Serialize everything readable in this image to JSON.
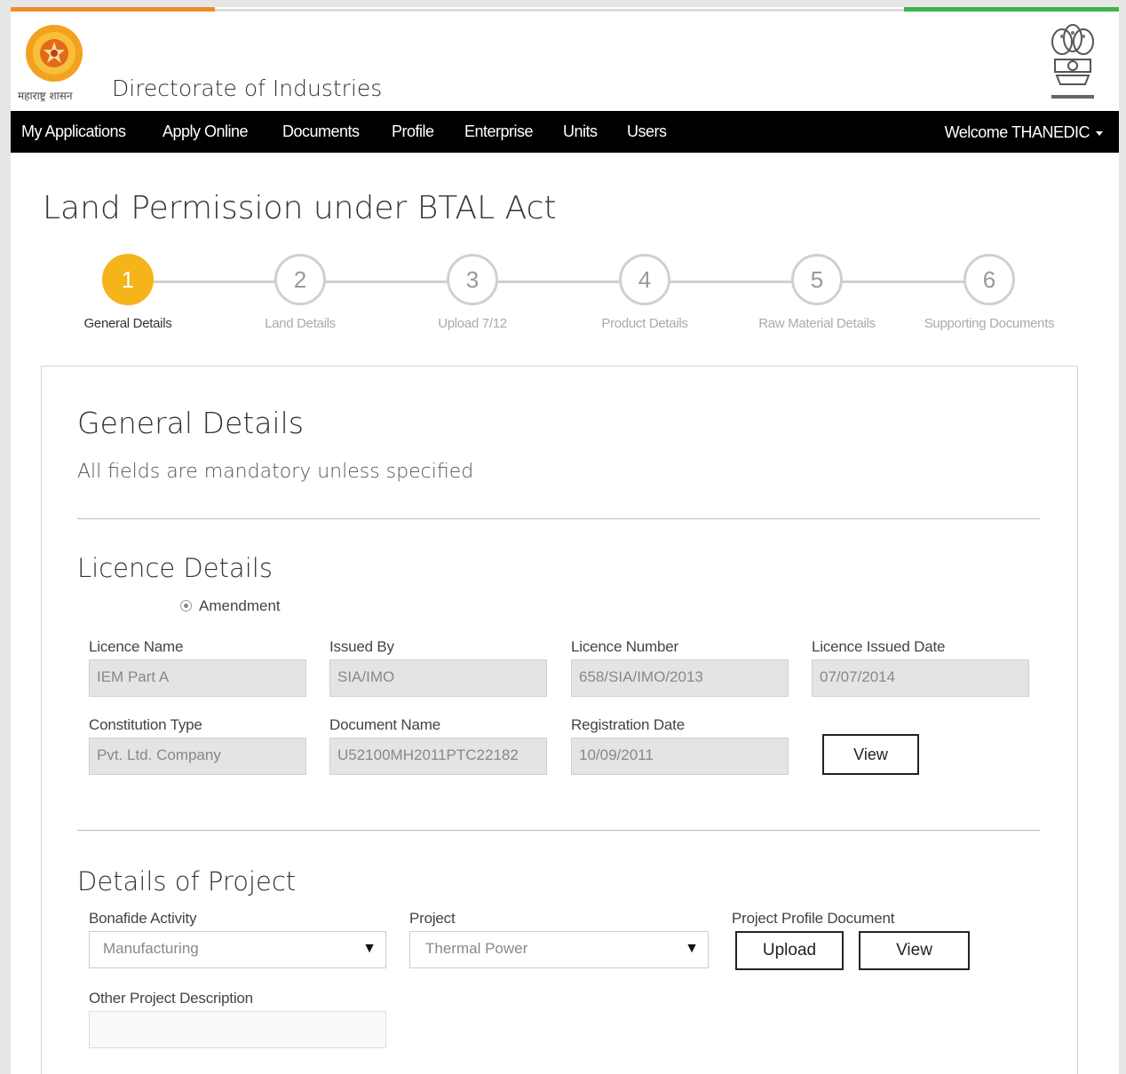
{
  "header": {
    "logo_caption": "महाराष्ट्र शासन",
    "site_title": "Directorate of Industries",
    "stripe_colors": {
      "orange": "#f28c28",
      "green": "#3cb44b"
    },
    "left_logo_icon": "maharashtra-seal-icon",
    "right_logo_icon": "national-emblem-icon"
  },
  "nav": {
    "items": [
      "My Applications",
      "Apply Online",
      "Documents",
      "Profile",
      "Enterprise",
      "Units",
      "Users"
    ],
    "welcome": "Welcome THANEDIC"
  },
  "page_title": "Land Permission under BTAL Act",
  "wizard": {
    "accent_color": "#f4b41a",
    "steps": [
      {
        "num": "1",
        "label": "General Details",
        "active": true
      },
      {
        "num": "2",
        "label": "Land Details",
        "active": false
      },
      {
        "num": "3",
        "label": "Upload 7/12",
        "active": false
      },
      {
        "num": "4",
        "label": "Product Details",
        "active": false
      },
      {
        "num": "5",
        "label": "Raw Material Details",
        "active": false
      },
      {
        "num": "6",
        "label": "Supporting Documents",
        "active": false
      }
    ]
  },
  "general": {
    "title": "General Details",
    "note": "All fields are mandatory unless specified"
  },
  "licence": {
    "title": "Licence Details",
    "radio_label": "Amendment",
    "fields": {
      "licence_name": {
        "label": "Licence Name",
        "value": "IEM Part A"
      },
      "issued_by": {
        "label": "Issued By",
        "value": "SIA/IMO"
      },
      "licence_number": {
        "label": "Licence Number",
        "value": "658/SIA/IMO/2013"
      },
      "licence_issued_date": {
        "label": "Licence Issued Date",
        "value": "07/07/2014"
      },
      "constitution_type": {
        "label": "Constitution Type",
        "value": "Pvt. Ltd. Company"
      },
      "document_name": {
        "label": "Document Name",
        "value": "U52100MH2011PTC22182"
      },
      "registration_date": {
        "label": "Registration Date",
        "value": "10/09/2011"
      }
    },
    "view_label": "View"
  },
  "project": {
    "title": "Details of Project",
    "bonafide_activity": {
      "label": "Bonafide Activity",
      "value": "Manufacturing"
    },
    "project": {
      "label": "Project",
      "value": "Thermal Power"
    },
    "profile_doc": {
      "label": "Project Profile Document",
      "upload_label": "Upload",
      "view_label": "View"
    },
    "other_description": {
      "label": "Other Project Description",
      "value": ""
    }
  }
}
